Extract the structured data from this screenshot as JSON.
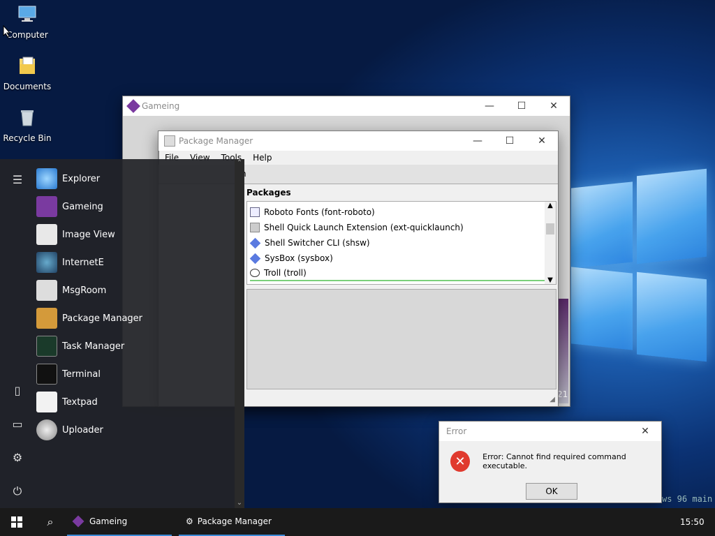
{
  "desktop": {
    "icons": [
      {
        "label": "Computer"
      },
      {
        "label": "Documents"
      },
      {
        "label": "Recycle Bin"
      }
    ],
    "watermark": "ws 96 main"
  },
  "gameing_window": {
    "title": "Gameing",
    "corner_text": "21"
  },
  "package_manager": {
    "title": "Package Manager",
    "menu": [
      "File",
      "View",
      "Tools",
      "Help"
    ],
    "toolbar_text": "n",
    "section_label": "Packages",
    "packages": [
      {
        "name": "Roboto Fonts (font-roboto)"
      },
      {
        "name": "Shell Quick Launch Extension (ext-quicklaunch)"
      },
      {
        "name": "Shell Switcher CLI (shsw)"
      },
      {
        "name": "SysBox (sysbox)"
      },
      {
        "name": "Troll (troll)"
      }
    ]
  },
  "start_menu": {
    "apps": [
      {
        "label": "Explorer"
      },
      {
        "label": "Gameing"
      },
      {
        "label": "Image View"
      },
      {
        "label": "InternetE"
      },
      {
        "label": "MsgRoom"
      },
      {
        "label": "Package Manager"
      },
      {
        "label": "Task Manager"
      },
      {
        "label": "Terminal"
      },
      {
        "label": "Textpad"
      },
      {
        "label": "Uploader"
      }
    ]
  },
  "error_dialog": {
    "title": "Error",
    "message": "Error: Cannot find required command executable.",
    "ok_label": "OK"
  },
  "taskbar": {
    "items": [
      {
        "label": "Gameing"
      },
      {
        "label": "Package Manager"
      }
    ],
    "clock": "15:50"
  },
  "colors": {
    "accent": "#3a8ad8",
    "error_red": "#e03a2e"
  }
}
